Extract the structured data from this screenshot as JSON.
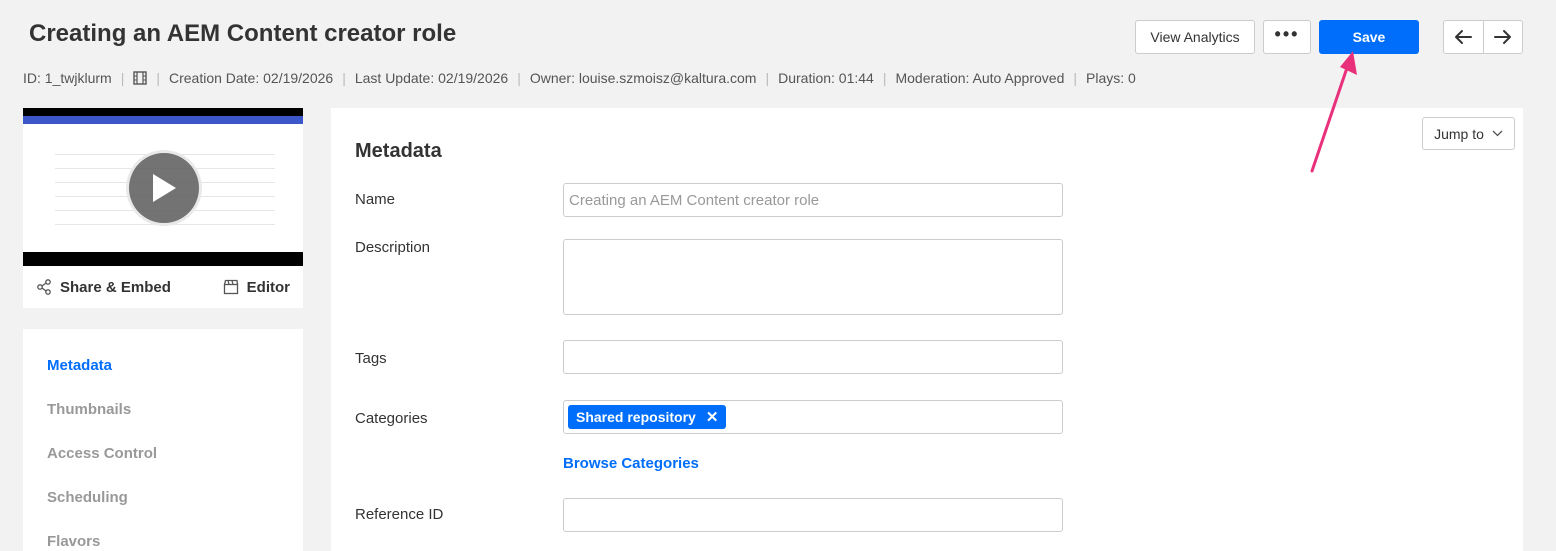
{
  "header": {
    "title": "Creating an AEM Content creator role",
    "view_analytics_label": "View Analytics",
    "more_label": "•••",
    "save_label": "Save"
  },
  "meta": {
    "id": "ID: 1_twjklurm",
    "creation_date": "Creation Date: 02/19/2026",
    "last_update": "Last Update: 02/19/2026",
    "owner": "Owner: louise.szmoisz@kaltura.com",
    "duration": "Duration: 01:44",
    "moderation": "Moderation: Auto Approved",
    "plays": "Plays: 0"
  },
  "preview": {
    "share_label": "Share & Embed",
    "editor_label": "Editor"
  },
  "sidebar": {
    "items": [
      {
        "label": "Metadata",
        "active": true
      },
      {
        "label": "Thumbnails",
        "active": false
      },
      {
        "label": "Access Control",
        "active": false
      },
      {
        "label": "Scheduling",
        "active": false
      },
      {
        "label": "Flavors",
        "active": false
      }
    ]
  },
  "panel": {
    "jump_label": "Jump to",
    "section_title": "Metadata",
    "name_label": "Name",
    "name_placeholder": "Creating an AEM Content creator role",
    "description_label": "Description",
    "tags_label": "Tags",
    "categories_label": "Categories",
    "category_chip": "Shared repository",
    "browse_label": "Browse Categories",
    "reference_label": "Reference ID"
  },
  "colors": {
    "primary": "#006efa",
    "annotation_arrow": "#e8317a"
  }
}
